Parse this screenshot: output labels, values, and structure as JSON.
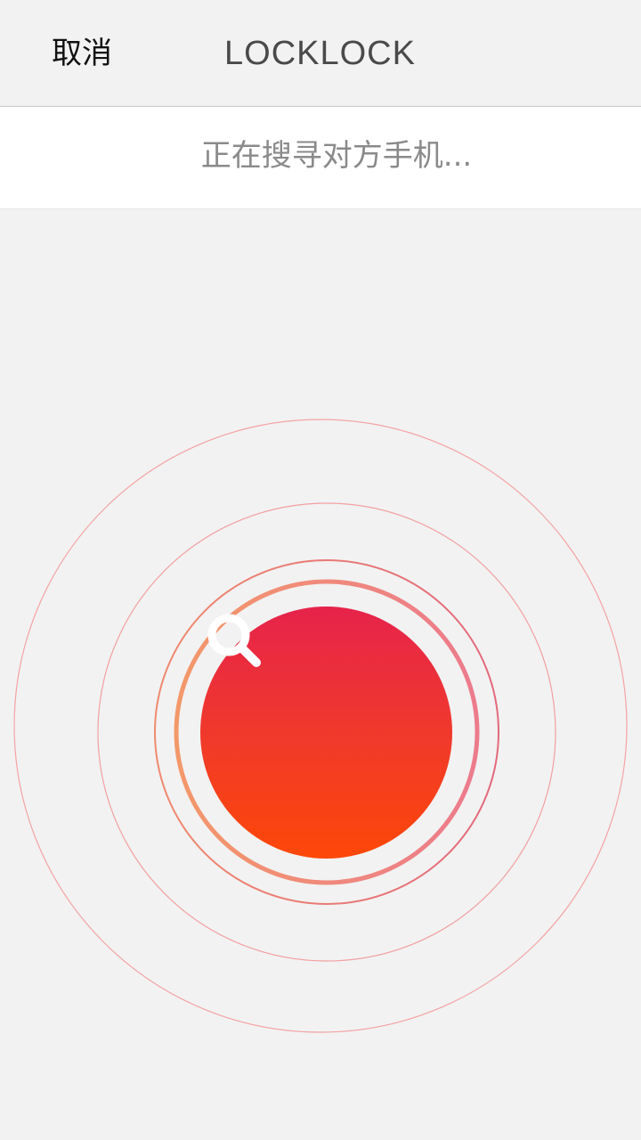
{
  "header": {
    "cancel_label": "取消",
    "title": "LOCKLOCK"
  },
  "status": {
    "text": "正在搜寻对方手机..."
  },
  "radar": {
    "action_icon": "search-icon",
    "colors": {
      "ring_outer": "#f5a3a3",
      "ring_mid": "#f09090",
      "ring_inner_left": "#f3986a",
      "ring_inner_right": "#ec7b8c",
      "button_top": "#e6234b",
      "button_bottom": "#fd4708",
      "icon": "#ffffff"
    }
  }
}
